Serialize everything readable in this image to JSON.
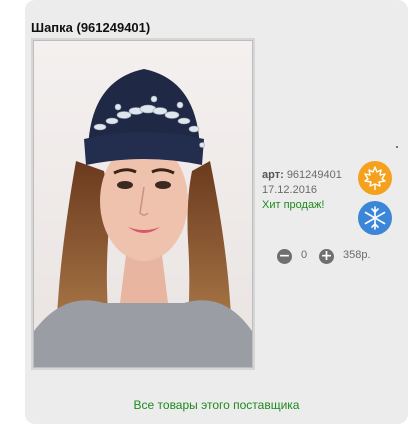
{
  "product": {
    "title": "Шапка (961249401)",
    "art_label": "арт:",
    "art_number": "961249401",
    "date": "17.12.2016",
    "badge": "Хит продаж!",
    "quantity": "0",
    "price": "358р.",
    "season_icons": [
      "maple-leaf-icon",
      "snowflake-icon"
    ]
  },
  "supplier_link": "Все товары этого поставщика",
  "colors": {
    "autumn": "#f5a11e",
    "winter": "#3b86d6",
    "link_green": "#1d8a1d"
  }
}
